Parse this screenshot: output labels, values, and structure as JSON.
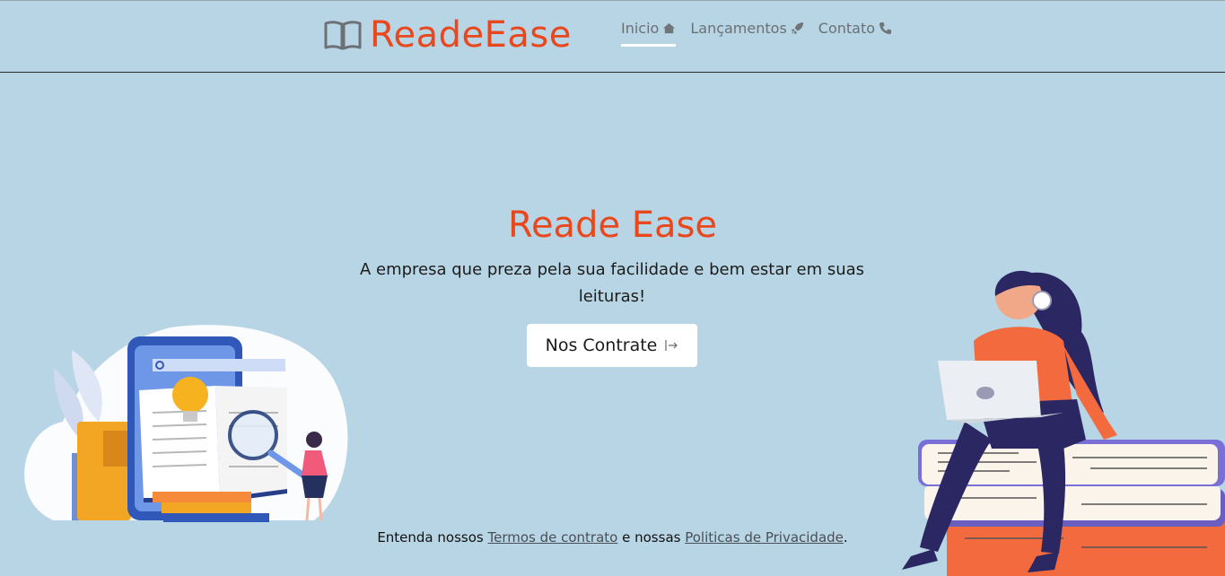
{
  "brand": {
    "name": "ReadeEase",
    "icon": "book-open-icon"
  },
  "nav": {
    "items": [
      {
        "label": "Inicio",
        "icon": "home-icon",
        "active": true
      },
      {
        "label": "Lançamentos",
        "icon": "rocket-icon",
        "active": false
      },
      {
        "label": "Contato",
        "icon": "phone-icon",
        "active": false
      }
    ]
  },
  "hero": {
    "title": "Reade Ease",
    "subtitle": "A empresa que preza pela sua facilidade e bem estar em suas leituras!",
    "cta_label": "Nos Contrate",
    "cta_icon": "sign-in-icon"
  },
  "footer": {
    "prefix": "Entenda nossos ",
    "terms_link": "Termos de contrato",
    "middle": " e nossas ",
    "privacy_link": "Politicas de Privacidade",
    "suffix": "."
  },
  "colors": {
    "background": "#b7d5e4",
    "accent": "#e9481d",
    "text": "#1c1c1c"
  }
}
